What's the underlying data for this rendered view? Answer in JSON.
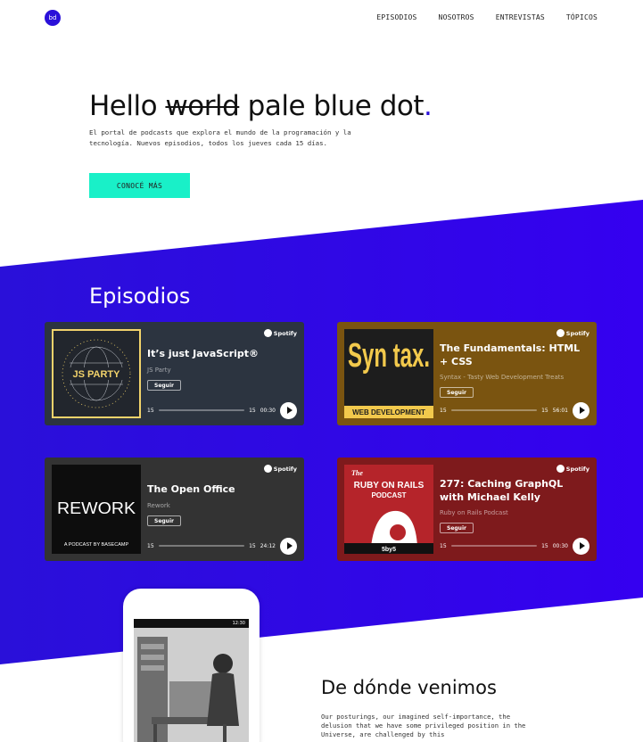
{
  "header": {
    "logo_text": "bd",
    "nav": [
      "EPISODIOS",
      "NOSOTROS",
      "ENTREVISTAS",
      "TÓPICOS"
    ]
  },
  "hero": {
    "title_start": "Hello ",
    "title_strike": "world",
    "title_end": " pale blue dot",
    "title_dot": ".",
    "subtitle": "El portal de podcasts que explora el mundo de la programación y la tecnología. Nuevos episodios, todos los jueves cada 15 días.",
    "cta_label": "CONOCÉ MÁS"
  },
  "episodes": {
    "title": "Episodios",
    "cards": [
      {
        "title": "It’s just JavaScript®",
        "show": "JS Party",
        "follow": "Seguir",
        "spotify": "Spotify",
        "skip_back": "15",
        "skip_fwd": "15",
        "time": "00:30",
        "art_text": "JS PARTY",
        "bg": "#2c3440"
      },
      {
        "title": "The Fundamentals: HTML + CSS",
        "show": "Syntax - Tasty Web Development Treats",
        "follow": "Seguir",
        "spotify": "Spotify",
        "skip_back": "15",
        "skip_fwd": "15",
        "time": "56:01",
        "art_text": "Syn tax.",
        "art_sub": "WEB DEVELOPMENT",
        "bg": "#7a5410"
      },
      {
        "title": "The Open Office",
        "show": "Rework",
        "follow": "Seguir",
        "spotify": "Spotify",
        "skip_back": "15",
        "skip_fwd": "15",
        "time": "24:12",
        "art_text": "REWORK",
        "art_sub": "A PODCAST BY BASECAMP",
        "bg": "#333333"
      },
      {
        "title": "277: Caching GraphQL with Michael Kelly",
        "show": "Ruby on Rails Podcast",
        "follow": "Seguir",
        "spotify": "Spotify",
        "skip_back": "15",
        "skip_fwd": "15",
        "time": "00:30",
        "art_text": "RUBY ON RAILS",
        "art_pre": "The",
        "art_sub": "PODCAST",
        "art_badge": "5by5",
        "bg": "#7e1a1c"
      }
    ]
  },
  "phone": {
    "status_time": "12:30"
  },
  "origin": {
    "title": "De dónde venimos",
    "text": "Our posturings, our imagined self-importance, the delusion that we have some privileged position in the Universe, are challenged by this"
  },
  "colors": {
    "brand_blue": "#2a10d9",
    "accent": "#19f0c8"
  }
}
